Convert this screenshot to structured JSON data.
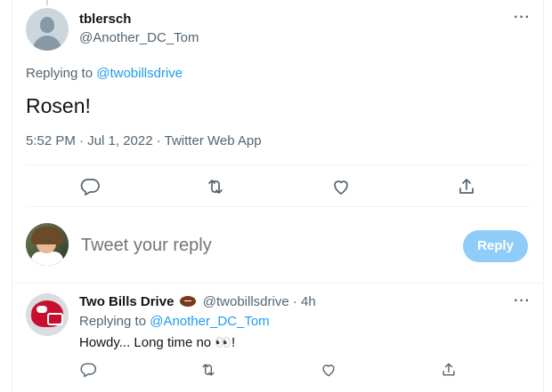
{
  "tweet": {
    "author_name": "tblersch",
    "author_handle": "@Another_DC_Tom",
    "replying_label": "Replying to ",
    "replying_to": "@twobillsdrive",
    "text": "Rosen!",
    "meta": "5:52 PM · Jul 1, 2022 · Twitter Web App",
    "more_icon": "more-horizontal-icon"
  },
  "actions": [
    "reply-icon",
    "retweet-icon",
    "like-icon",
    "share-icon"
  ],
  "composer": {
    "placeholder": "Tweet your reply",
    "button_label": "Reply",
    "button_color": "#8ecdf8"
  },
  "reply": {
    "author_name": "Two Bills Drive",
    "author_emoji": "football-emoji",
    "handle_time": "@twobillsdrive · 4h",
    "replying_label": "Replying to ",
    "replying_to": "@Another_DC_Tom",
    "text": "Howdy... Long time no 👀!"
  },
  "colors": {
    "link": "#1d9bf0",
    "secondary_text": "#536471",
    "border": "#eff3f4"
  }
}
